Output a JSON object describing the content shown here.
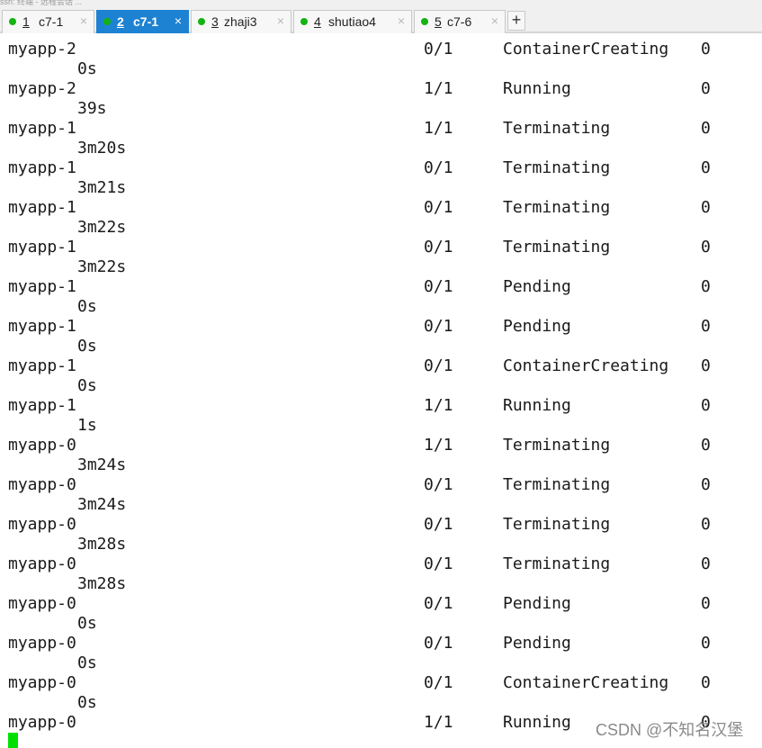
{
  "window": {
    "title_strip": "ssh: 终端 - 远程会话 ..."
  },
  "tabs": [
    {
      "number": "1",
      "title": "c7-1",
      "active": false
    },
    {
      "number": "2",
      "title": "c7-1",
      "active": true
    },
    {
      "number": "3",
      "title": "zhaji3",
      "active": false
    },
    {
      "number": "4",
      "title": "shutiao4",
      "active": false
    },
    {
      "number": "5",
      "title": "c7-6",
      "active": false
    }
  ],
  "icons": {
    "tab_status": "green-dot-icon",
    "tab_close": "close-icon",
    "new_tab": "plus-icon"
  },
  "symbols": {
    "close": "×",
    "plus": "+"
  },
  "colors": {
    "active_tab": "#1e82d2",
    "status_dot": "#12b312",
    "cursor": "#00e000"
  },
  "terminal": {
    "rows": [
      {
        "name": "myapp-2",
        "ready": "0/1",
        "status": "ContainerCreating",
        "restarts": "0",
        "age": "0s"
      },
      {
        "name": "myapp-2",
        "ready": "1/1",
        "status": "Running",
        "restarts": "0",
        "age": "39s"
      },
      {
        "name": "myapp-1",
        "ready": "1/1",
        "status": "Terminating",
        "restarts": "0",
        "age": "3m20s"
      },
      {
        "name": "myapp-1",
        "ready": "0/1",
        "status": "Terminating",
        "restarts": "0",
        "age": "3m21s"
      },
      {
        "name": "myapp-1",
        "ready": "0/1",
        "status": "Terminating",
        "restarts": "0",
        "age": "3m22s"
      },
      {
        "name": "myapp-1",
        "ready": "0/1",
        "status": "Terminating",
        "restarts": "0",
        "age": "3m22s"
      },
      {
        "name": "myapp-1",
        "ready": "0/1",
        "status": "Pending",
        "restarts": "0",
        "age": "0s"
      },
      {
        "name": "myapp-1",
        "ready": "0/1",
        "status": "Pending",
        "restarts": "0",
        "age": "0s"
      },
      {
        "name": "myapp-1",
        "ready": "0/1",
        "status": "ContainerCreating",
        "restarts": "0",
        "age": "0s"
      },
      {
        "name": "myapp-1",
        "ready": "1/1",
        "status": "Running",
        "restarts": "0",
        "age": "1s"
      },
      {
        "name": "myapp-0",
        "ready": "1/1",
        "status": "Terminating",
        "restarts": "0",
        "age": "3m24s"
      },
      {
        "name": "myapp-0",
        "ready": "0/1",
        "status": "Terminating",
        "restarts": "0",
        "age": "3m24s"
      },
      {
        "name": "myapp-0",
        "ready": "0/1",
        "status": "Terminating",
        "restarts": "0",
        "age": "3m28s"
      },
      {
        "name": "myapp-0",
        "ready": "0/1",
        "status": "Terminating",
        "restarts": "0",
        "age": "3m28s"
      },
      {
        "name": "myapp-0",
        "ready": "0/1",
        "status": "Pending",
        "restarts": "0",
        "age": "0s"
      },
      {
        "name": "myapp-0",
        "ready": "0/1",
        "status": "Pending",
        "restarts": "0",
        "age": "0s"
      },
      {
        "name": "myapp-0",
        "ready": "0/1",
        "status": "ContainerCreating",
        "restarts": "0",
        "age": "0s"
      },
      {
        "name": "myapp-0",
        "ready": "1/1",
        "status": "Running",
        "restarts": "0",
        "age": ""
      }
    ]
  },
  "watermark": "CSDN @不知名汉堡"
}
